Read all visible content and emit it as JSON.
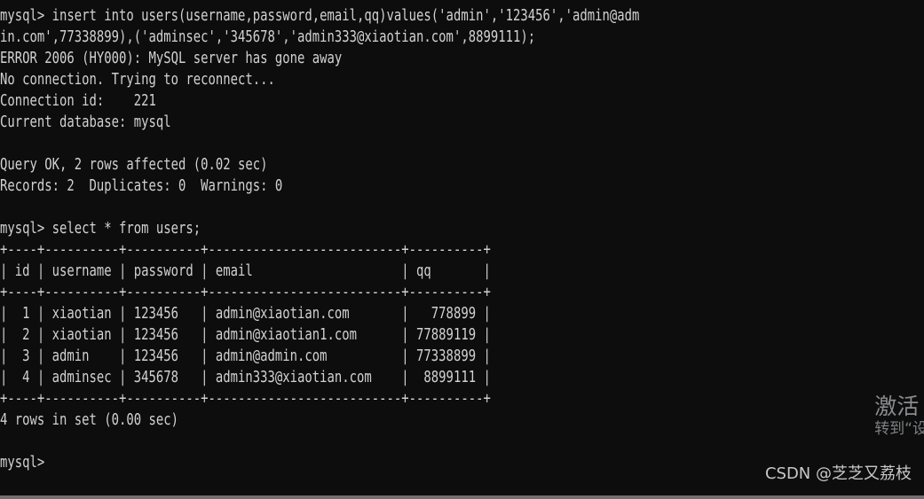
{
  "terminal": {
    "prompt": "mysql>",
    "background_color": "#0d0d0d",
    "text_color": "#d2d2d2",
    "lines": [
      "mysql> insert into users(username,password,email,qq)values('admin','123456','admin@adm",
      "in.com',77338899),('adminsec','345678','admin333@xiaotian.com',8899111);",
      "ERROR 2006 (HY000): MySQL server has gone away",
      "No connection. Trying to reconnect...",
      "Connection id:    221",
      "Current database: mysql",
      "",
      "Query OK, 2 rows affected (0.02 sec)",
      "Records: 2  Duplicates: 0  Warnings: 0",
      "",
      "mysql> select * from users;",
      "+----+----------+----------+--------------------------+----------+",
      "| id | username | password | email                    | qq       |",
      "+----+----------+----------+--------------------------+----------+",
      "|  1 | xiaotian | 123456   | admin@xiaotian.com       |   778899 |",
      "|  2 | xiaotian | 123456   | admin@xiaotian1.com      | 77889119 |",
      "|  3 | admin    | 123456   | admin@admin.com          | 77338899 |",
      "|  4 | adminsec | 345678   | admin333@xiaotian.com    |  8899111 |",
      "+----+----------+----------+--------------------------+----------+",
      "4 rows in set (0.00 sec)",
      "",
      "mysql>"
    ]
  },
  "result_table": {
    "columns": [
      "id",
      "username",
      "password",
      "email",
      "qq"
    ],
    "rows": [
      [
        "1",
        "xiaotian",
        "123456",
        "admin@xiaotian.com",
        "778899"
      ],
      [
        "2",
        "xiaotian",
        "123456",
        "admin@xiaotian1.com",
        "77889119"
      ],
      [
        "3",
        "admin",
        "123456",
        "admin@admin.com",
        "77338899"
      ],
      [
        "4",
        "adminsec",
        "345678",
        "admin333@xiaotian.com",
        "8899111"
      ]
    ],
    "row_count_status": "4 rows in set (0.00 sec)"
  },
  "statements": {
    "insert_query": "insert into users(username,password,email,qq)values('admin','123456','admin@admin.com',77338899),('adminsec','345678','admin333@xiaotian.com',8899111);",
    "select_query": "select * from users;",
    "error_message": "ERROR 2006 (HY000): MySQL server has gone away",
    "reconnect_message": "No connection. Trying to reconnect...",
    "connection_id_label": "Connection id:",
    "connection_id_value": "221",
    "current_database_label": "Current database:",
    "current_database_value": "mysql",
    "insert_status": "Query OK, 2 rows affected (0.02 sec)",
    "insert_records": "Records: 2  Duplicates: 0  Warnings: 0"
  },
  "watermarks": {
    "activation_title": "激活",
    "activation_subtitle": "转到“设",
    "csdn": "CSDN @芝芝又荔枝"
  }
}
